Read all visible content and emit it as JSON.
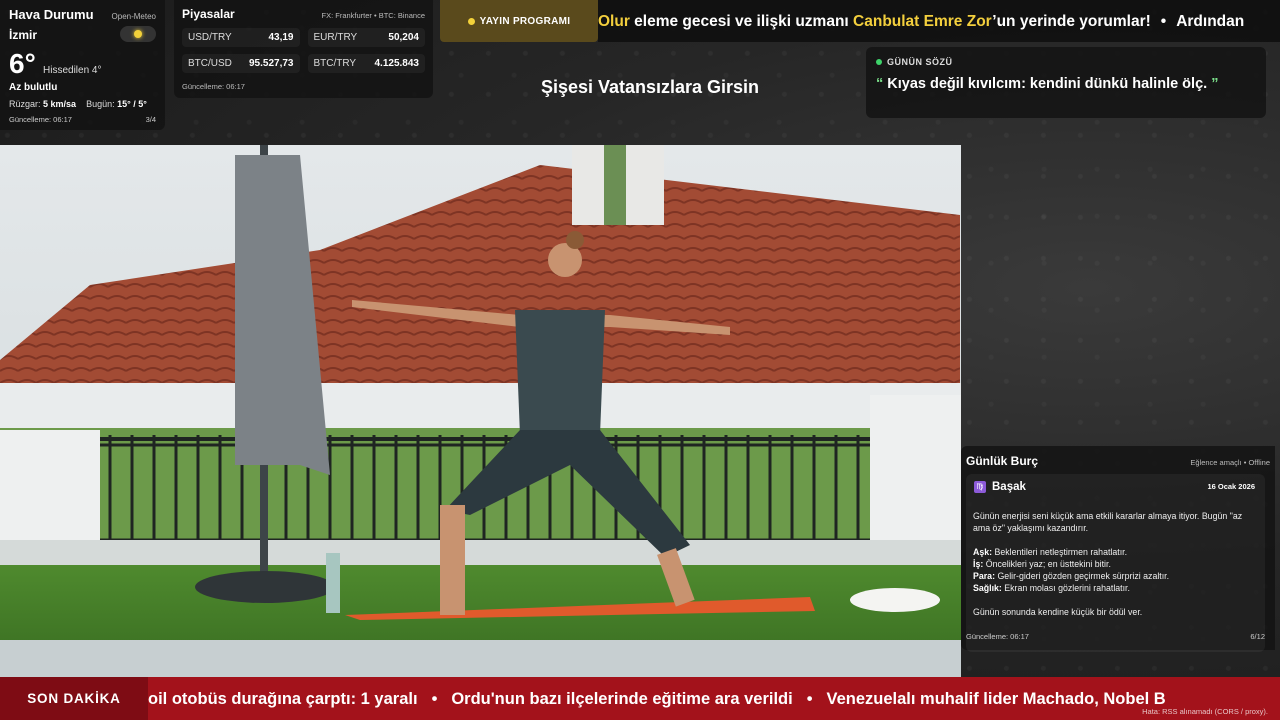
{
  "weather": {
    "title": "Hava Durumu",
    "source": "Open-Meteo",
    "city": "İzmir",
    "temp": "6°",
    "feels": "Hissedilen 4°",
    "condition": "Az bulutlu",
    "wind_label": "Rüzgar:",
    "wind_value": "5 km/sa",
    "today_label": "Bugün:",
    "today_value": "15° / 5°",
    "updated": "Güncelleme: 06:17",
    "page": "3/4",
    "icon": "partly-cloudy-icon"
  },
  "markets": {
    "title": "Piyasalar",
    "source": "FX: Frankfurter • BTC: Binance",
    "items": [
      {
        "label": "USD/TRY",
        "value": "43,19"
      },
      {
        "label": "EUR/TRY",
        "value": "50,204"
      },
      {
        "label": "BTC/USD",
        "value": "95.527,73"
      },
      {
        "label": "BTC/TRY",
        "value": "4.125.843"
      }
    ],
    "updated": "Güncelleme: 06:17"
  },
  "program": {
    "label": "YAYIN PROGRAMI"
  },
  "top_ticker": {
    "pre": "Olur",
    "mid": " eleme gecesi ve ilişki uzmanı ",
    "highlight": "Canbulat Emre Zor",
    "post": "’un yerinde yorumlar!",
    "next": "Ardından"
  },
  "show_title": "Şişesi Vatansızlara Girsin",
  "quote": {
    "label": "GÜNÜN SÖZÜ",
    "open": "“",
    "text": " Kıyas değil kıvılcım: kendini dünkü halinle ölç. ",
    "close": "”"
  },
  "horoscope": {
    "title": "Günlük Burç",
    "source": "Eğlence amaçlı • Offline",
    "sign": "Başak",
    "sign_icon": "virgo-icon",
    "date": "16 Ocak 2026",
    "intro": "Günün enerjisi seni küçük ama etkili kararlar almaya itiyor. Bugün \"az ama öz\" yaklaşımı kazandırır.",
    "rows": [
      {
        "label": "Aşk:",
        "text": " Beklentileri netleştirmen rahatlatır."
      },
      {
        "label": "İş:",
        "text": " Öncelikleri yaz; en üsttekini bitir."
      },
      {
        "label": "Para:",
        "text": " Gelir-gideri gözden geçirmek sürprizi azaltır."
      },
      {
        "label": "Sağlık:",
        "text": " Ekran molası gözlerini rahatlatır."
      }
    ],
    "closing": "Günün sonunda kendine küçük bir ödül ver.",
    "updated": "Güncelleme: 06:17",
    "page": "6/12"
  },
  "breaking": {
    "label": "SON DAKİKA",
    "items": [
      "oil otobüs durağına çarptı: 1 yaralı",
      "Ordu'nun bazı ilçelerinde eğitime ara verildi",
      "Venezuelalı muhalif lider Machado, Nobel B"
    ],
    "separator": "•",
    "note": "Hata: RSS alınamadı (CORS / proxy)."
  },
  "colors": {
    "breaking_bg": "#a3121b",
    "breaking_label_bg": "#7e0c14",
    "highlight": "#f3cf3d",
    "quote_accent": "#7be08b",
    "live_dot": "#3ed36a"
  }
}
